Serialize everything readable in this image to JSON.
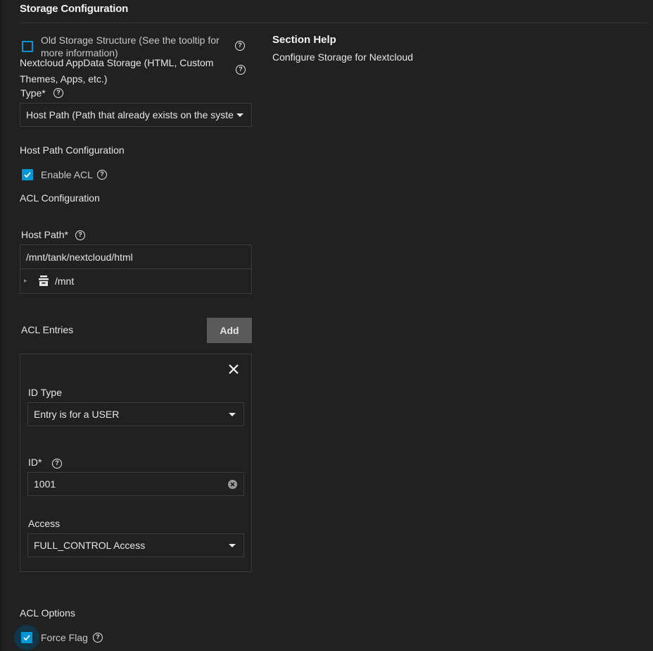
{
  "section": {
    "title": "Storage Configuration"
  },
  "help": {
    "title": "Section Help",
    "text": "Configure Storage for Nextcloud"
  },
  "old_storage": {
    "label_line1": "Old Storage Structure (See the tooltip for",
    "label_line2": "more information)",
    "checked": false
  },
  "appdata": {
    "label_line1": "Nextcloud AppData Storage (HTML, Custom",
    "label_line2": "Themes, Apps, etc.)"
  },
  "type": {
    "label": "Type",
    "required": "*",
    "value": "Host Path (Path that already exists on the syste"
  },
  "host_path_config": {
    "heading": "Host Path Configuration",
    "enable_acl_label": "Enable ACL",
    "enable_acl_checked": true,
    "acl_config_heading": "ACL Configuration"
  },
  "host_path": {
    "label": "Host Path",
    "required": "*",
    "value": "/mnt/tank/nextcloud/html",
    "tree_root": "/mnt",
    "tree_expander": "▸"
  },
  "acl_entries": {
    "heading": "ACL Entries",
    "add_label": "Add",
    "entry": {
      "id_type_label": "ID Type",
      "id_type_value": "Entry is for a USER",
      "id_label": "ID",
      "id_required": "*",
      "id_value": "1001",
      "access_label": "Access",
      "access_value": "FULL_CONTROL Access"
    }
  },
  "acl_options": {
    "heading": "ACL Options",
    "force_flag_label": "Force Flag",
    "force_flag_checked": true
  },
  "colors": {
    "background": "#212121",
    "accent": "#0095d5",
    "button": "#5a5a5a"
  }
}
